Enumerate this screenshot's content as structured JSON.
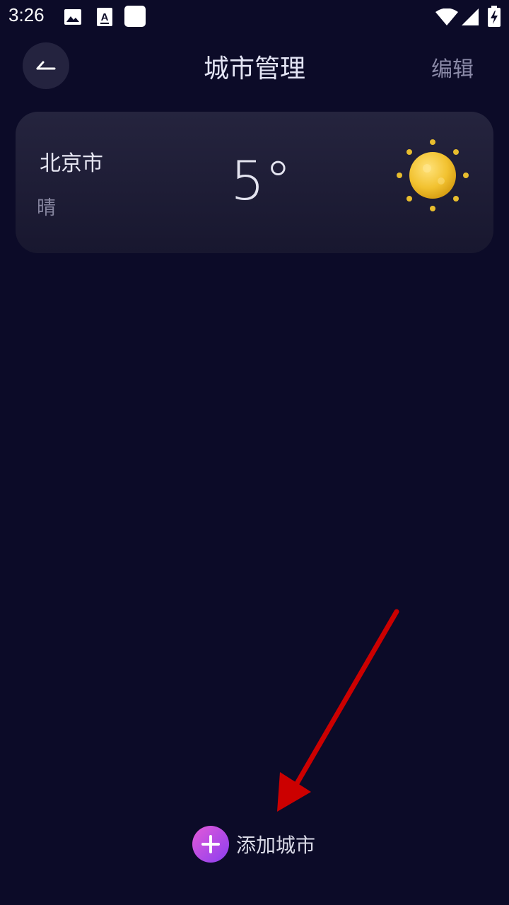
{
  "status_bar": {
    "time": "3:26",
    "icons": [
      "image-icon",
      "font-icon",
      "blank-square-icon",
      "wifi-icon",
      "signal-icon",
      "battery-charging-icon"
    ]
  },
  "header": {
    "back_icon": "back-arrow-icon",
    "title": "城市管理",
    "edit_label": "编辑"
  },
  "city_card": {
    "name": "北京市",
    "weather": "晴",
    "temperature": "5°",
    "weather_icon": "sun-icon"
  },
  "add_city": {
    "icon": "plus-icon",
    "label": "添加城市"
  },
  "colors": {
    "background": "#0c0b28",
    "card": "#25243e",
    "accent_start": "#e45ad8",
    "accent_end": "#8a3ef0",
    "sun": "#f2c230",
    "annotation_arrow": "#cc0000"
  }
}
